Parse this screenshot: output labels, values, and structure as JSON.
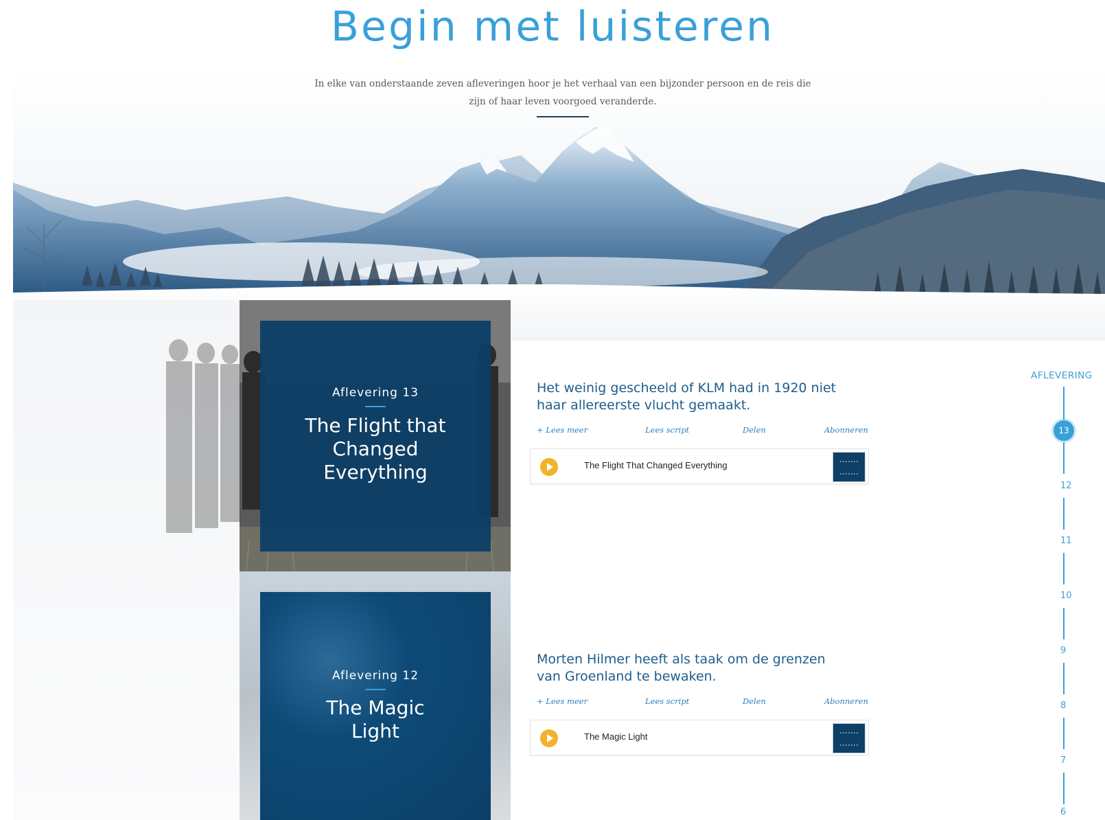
{
  "header": {
    "title": "Begin met luisteren",
    "intro_line1": "In elke van onderstaande zeven afleveringen hoor je het verhaal van een bijzonder persoon en de reis die",
    "intro_line2": "zijn of haar leven voorgoed veranderde."
  },
  "episodes": [
    {
      "label": "Aflevering 13",
      "title_lines": [
        "The Flight that",
        "Changed",
        "Everything"
      ],
      "desc_lines": [
        "Het weinig gescheeld of KLM had in 1920 niet",
        "haar allereerste vlucht gemaakt."
      ],
      "links": {
        "read_more": "+ Lees meer",
        "read_script": "Lees script",
        "share": "Delen",
        "subscribe": "Abonneren"
      },
      "player_title": "The Flight That Changed Everything"
    },
    {
      "label": "Aflevering 12",
      "title_lines": [
        "The Magic",
        "Light"
      ],
      "desc_lines": [
        "Morten Hilmer heeft als taak om de grenzen",
        "van Groenland te bewaken."
      ],
      "links": {
        "read_more": "+ Lees meer",
        "read_script": "Lees script",
        "share": "Delen",
        "subscribe": "Abonneren"
      },
      "player_title": "The Magic Light"
    }
  ],
  "timeline": {
    "label": "AFLEVERING",
    "active": "13",
    "numbers": [
      "12",
      "11",
      "10",
      "9",
      "8",
      "7",
      "6"
    ]
  },
  "colors": {
    "accent": "#3aa0d8",
    "card": "#0d3f66",
    "play": "#f3b22b",
    "link": "#2a7fc0"
  },
  "icons": {
    "play": "play-icon",
    "hero": "mountain-landscape"
  }
}
